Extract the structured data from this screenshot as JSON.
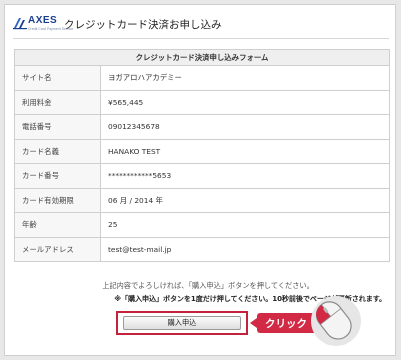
{
  "header": {
    "logo_word": "AXES",
    "logo_tagline": "Credit Card Payment Service",
    "title": "クレジットカード決済お申し込み"
  },
  "form": {
    "caption": "クレジットカード決済申し込みフォーム",
    "rows": [
      {
        "label": "サイト名",
        "value": "ヨガアロハアカデミー"
      },
      {
        "label": "利用料金",
        "value": "¥565,445"
      },
      {
        "label": "電話番号",
        "value": "09012345678"
      },
      {
        "label": "カード名義",
        "value": "HANAKO TEST"
      },
      {
        "label": "カード番号",
        "value": "************5653"
      },
      {
        "label": "カード有効期限",
        "value": "06 月 / 2014 年"
      },
      {
        "label": "年齢",
        "value": "25"
      },
      {
        "label": "メールアドレス",
        "value": "test@test-mail.jp"
      }
    ]
  },
  "notes": {
    "line1": "上記内容でよろしければ、「購入申込」ボタンを押してください。",
    "line2": "※「購入申込」ボタンを1度だけ押してください。10秒前後でページが更新されます。"
  },
  "buttons": {
    "purchase": "購入申込"
  },
  "callout": {
    "text": "クリック"
  },
  "colors": {
    "accent_red": "#d22a45",
    "brand_blue": "#1a3f8f"
  },
  "icons": [
    "axes-logo-icon",
    "mouse-icon"
  ]
}
